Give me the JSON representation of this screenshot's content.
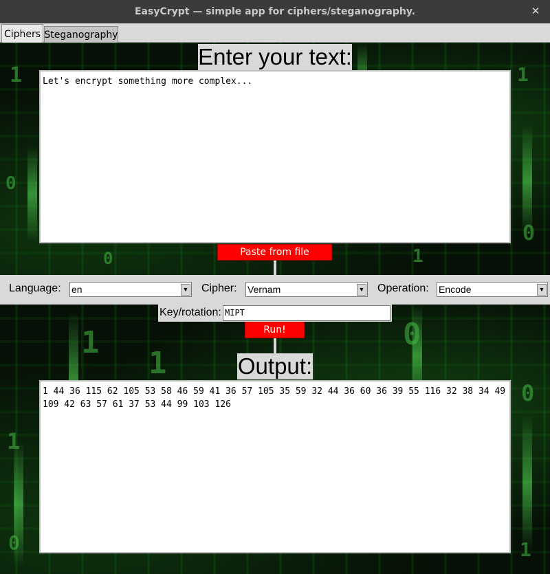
{
  "window": {
    "title": "EasyCrypt — simple app for ciphers/steganography.",
    "close_glyph": "✕"
  },
  "tabs": [
    {
      "label": "Ciphers",
      "active": true
    },
    {
      "label": "Steganography",
      "active": false
    }
  ],
  "input_section": {
    "heading": "Enter your text:",
    "text": "Let's encrypt something more complex...",
    "paste_button": "Paste from file"
  },
  "settings": {
    "language_label": "Language:",
    "language_value": "en",
    "cipher_label": "Cipher:",
    "cipher_value": "Vernam",
    "operation_label": "Operation:",
    "operation_value": "Encode",
    "key_label": "Key/rotation:",
    "key_value": "MIPT",
    "run_button": "Run!"
  },
  "output_section": {
    "heading": "Output:",
    "text": "1 44 36 115 62 105 53 58 46 59 41 36 57 105 35 59 32 44 36 60 36 39 55 116 32 38 34 49 109 42 63 57 61 37 53 44 99 103 126"
  },
  "colors": {
    "button_bg": "#ff0000",
    "matrix_green": "#1e8c1e",
    "panel_gray": "#d9d9d9"
  }
}
